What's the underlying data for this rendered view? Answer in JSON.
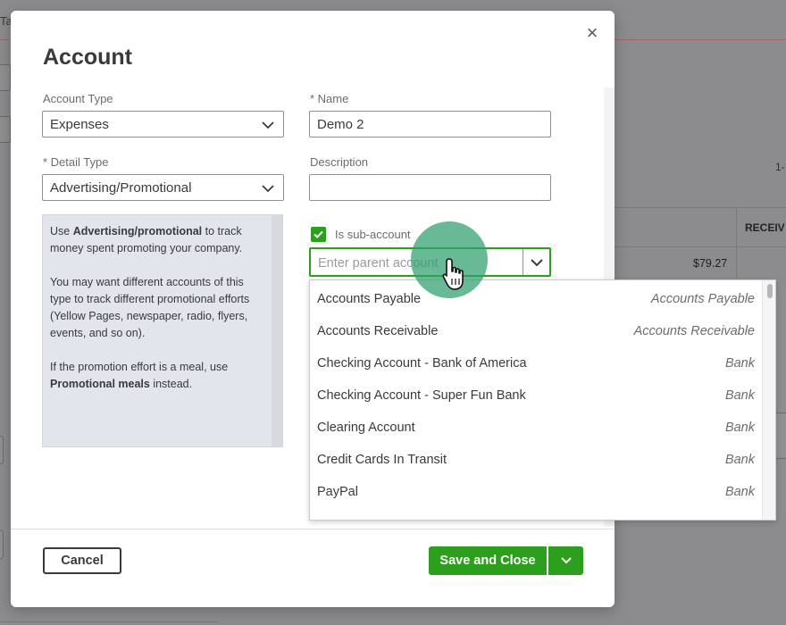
{
  "background": {
    "tab_fragment": "Ta",
    "text_1_dash": "1-",
    "receiv_header": "RECEIV",
    "amount": "$79.27"
  },
  "modal": {
    "title": "Account",
    "account_type": {
      "label": "Account Type",
      "value": "Expenses"
    },
    "name": {
      "label": "* Name",
      "value": "Demo 2"
    },
    "detail_type": {
      "label": "* Detail Type",
      "value": "Advertising/Promotional"
    },
    "description": {
      "label": "Description",
      "value": ""
    },
    "help": {
      "p1_prefix": "Use ",
      "p1_bold": "Advertising/promotional",
      "p1_suffix": " to track money spent promoting your company.",
      "p2": "You may want different accounts of this type to track different promotional efforts (Yellow Pages, newspaper, radio, flyers, events, and so on).",
      "p3_prefix": "If the promotion effort is a meal, use ",
      "p3_bold": "Promotional meals",
      "p3_suffix": " instead."
    },
    "sub_account": {
      "label": "Is sub-account",
      "checked": true
    },
    "parent_account": {
      "placeholder": "Enter parent account",
      "value": ""
    },
    "cancel_label": "Cancel",
    "save_label": "Save and Close"
  },
  "dropdown": {
    "items": [
      {
        "name": "Accounts Payable",
        "type": "Accounts Payable"
      },
      {
        "name": "Accounts Receivable",
        "type": "Accounts Receivable"
      },
      {
        "name": "Checking Account - Bank of America",
        "type": "Bank"
      },
      {
        "name": "Checking Account - Super Fun Bank",
        "type": "Bank"
      },
      {
        "name": "Clearing Account",
        "type": "Bank"
      },
      {
        "name": "Credit Cards In Transit",
        "type": "Bank"
      },
      {
        "name": "PayPal",
        "type": "Bank"
      }
    ]
  },
  "icons": {
    "close": "close-icon",
    "chevron": "chevron-down-icon",
    "check": "checkmark-icon",
    "cursor": "hand-pointer-icon"
  },
  "colors": {
    "accent_green": "#2ca01c",
    "text_dark": "#393a3d",
    "help_bg": "#e3e5ec",
    "overlay": "#8c8c8e"
  }
}
